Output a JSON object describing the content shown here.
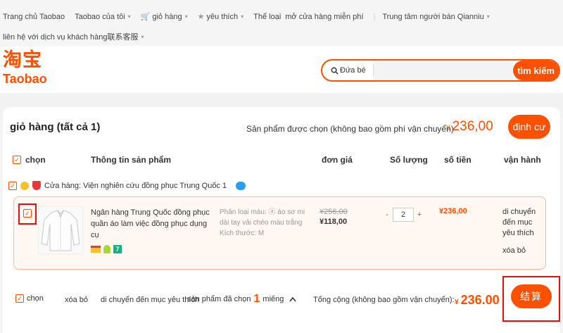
{
  "topnav": {
    "row1": [
      "Trang chủ Taobao",
      "Taobao của tôi",
      "giỏ hàng",
      "yêu thích",
      "Thể loại",
      "mở cửa hàng miễn phí",
      "Trung tâm người bán Qianniu"
    ],
    "row2": "liên hệ với dịch vụ khách hàng联系客服"
  },
  "logo": {
    "cn": "淘宝",
    "en": "Taobao"
  },
  "search": {
    "scope": "Đứa bé",
    "placeholder": "",
    "button": "tìm kiếm"
  },
  "cart": {
    "title": "giỏ hàng (tất cả 1)",
    "selected_label": "Sản phẩm được chọn (không bao gồm phí vận chuyển)",
    "currency": "¥",
    "selected_total": "236,00",
    "checkout_top": "định cư",
    "columns": {
      "select": "chọn",
      "info": "Thông tin sản phẩm",
      "unit_price": "đơn giá",
      "quantity": "Số lượng",
      "amount": "số tiền",
      "ops": "vận hành"
    },
    "store": "Cửa hàng: Viện nghiên cứu đồng phục Trung Quốc 1",
    "item": {
      "title": "Ngân hàng Trung Quốc đồng phục quần áo làm việc đồng phục dụng cụ",
      "spec_category": "Phân loại màu: ⓐ áo sơ mi dài tay vải chéo màu trắng",
      "spec_size": "Kích thước: M",
      "old_price": "¥256,00",
      "price": "¥118,00",
      "qty": "2",
      "qty_minus": "-",
      "qty_plus": "+",
      "subtotal": "¥236,00",
      "op_move": "di chuyển đến mục yêu thích",
      "op_delete": "xóa bỏ",
      "seven_badge": "7"
    },
    "footer": {
      "select_all": "chọn",
      "delete": "xóa bỏ",
      "move_fav": "di chuyển đến mục yêu thích",
      "selected_prefix": "sản phẩm đã chọn",
      "selected_count": "1",
      "selected_suffix": "miếng",
      "total_label": "Tổng cộng (không bao gồm vận chuyển):",
      "total": "236.00",
      "checkout": "结算"
    }
  }
}
